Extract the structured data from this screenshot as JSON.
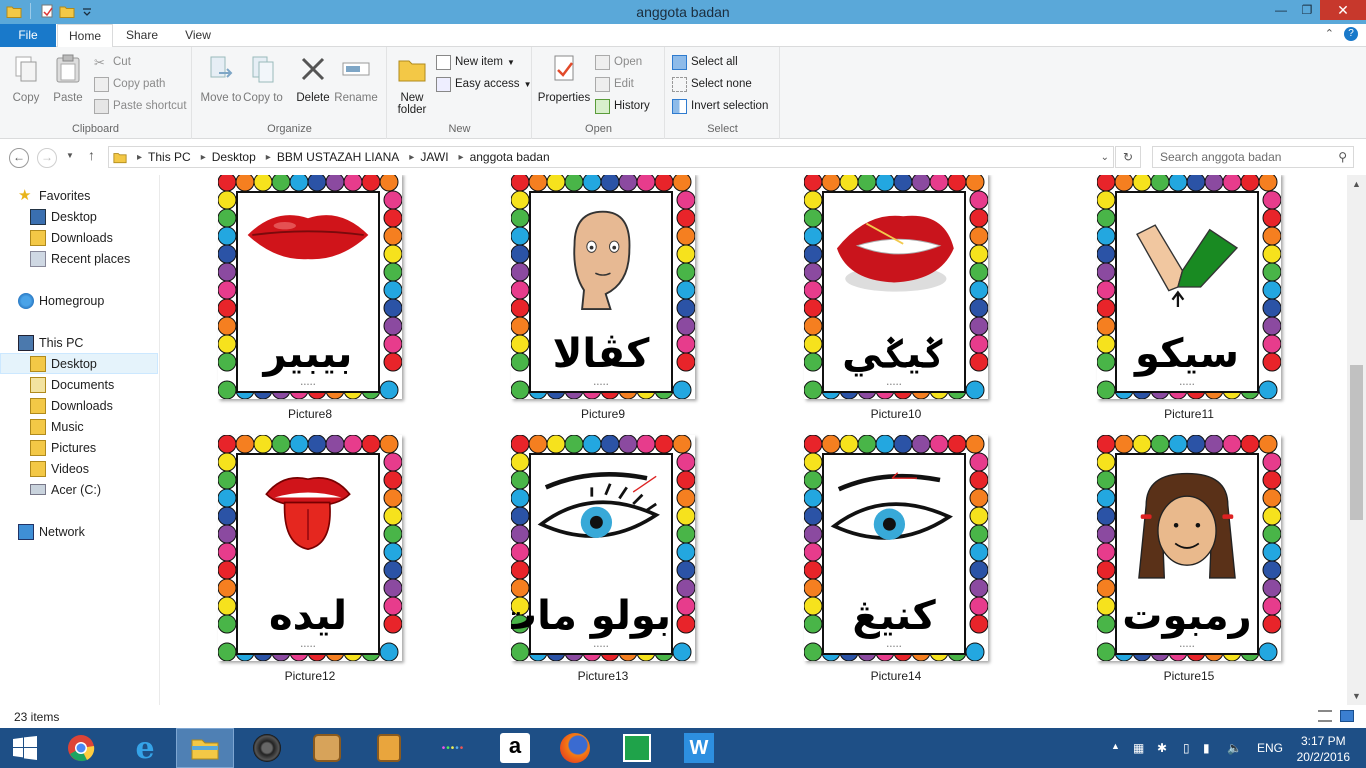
{
  "window": {
    "title": "anggota badan",
    "minimize": "—",
    "maximize": "❐",
    "close": "✕"
  },
  "ribbon_tabs": {
    "file": "File",
    "home": "Home",
    "share": "Share",
    "view": "View"
  },
  "ribbon": {
    "clipboard": {
      "label": "Clipboard",
      "copy": "Copy",
      "paste": "Paste",
      "cut": "Cut",
      "copy_path": "Copy path",
      "paste_shortcut": "Paste shortcut"
    },
    "organize": {
      "label": "Organize",
      "move_to": "Move to",
      "copy_to": "Copy to",
      "delete": "Delete",
      "rename": "Rename"
    },
    "new": {
      "label": "New",
      "new_folder": "New folder",
      "new_item": "New item",
      "easy_access": "Easy access"
    },
    "open": {
      "label": "Open",
      "properties": "Properties",
      "open": "Open",
      "edit": "Edit",
      "history": "History"
    },
    "select": {
      "label": "Select",
      "select_all": "Select all",
      "select_none": "Select none",
      "invert_selection": "Invert selection"
    }
  },
  "address": {
    "breadcrumbs": [
      "This PC",
      "Desktop",
      "BBM USTAZAH LIANA",
      "JAWI",
      "anggota badan"
    ],
    "search_placeholder": "Search anggota badan"
  },
  "nav": {
    "favorites": "Favorites",
    "fav_desktop": "Desktop",
    "fav_downloads": "Downloads",
    "recent_places": "Recent places",
    "homegroup": "Homegroup",
    "this_pc": "This PC",
    "desktop": "Desktop",
    "documents": "Documents",
    "downloads": "Downloads",
    "music": "Music",
    "pictures": "Pictures",
    "videos": "Videos",
    "drive": "Acer (C:)",
    "network": "Network"
  },
  "files": [
    {
      "name": "Picture8",
      "word": "بيبير",
      "picture": "lips-icon"
    },
    {
      "name": "Picture9",
      "word": "كڤالا",
      "picture": "head-icon"
    },
    {
      "name": "Picture10",
      "word": "ݢيݢي",
      "picture": "teeth-icon"
    },
    {
      "name": "Picture11",
      "word": "سيکو",
      "picture": "elbow-icon"
    },
    {
      "name": "Picture12",
      "word": "ليده",
      "picture": "tongue-icon"
    },
    {
      "name": "Picture13",
      "word": "بولو مات",
      "picture": "eyelash-icon"
    },
    {
      "name": "Picture14",
      "word": "كنيڠ",
      "picture": "eyebrow-icon"
    },
    {
      "name": "Picture15",
      "word": "رمبوت",
      "picture": "hair-icon"
    }
  ],
  "status": {
    "item_count": "23 items"
  },
  "taskbar": {
    "language": "ENG",
    "time": "3:17 PM",
    "date": "20/2/2016"
  },
  "colors": {
    "titlebar": "#5aa8d9",
    "file_tab": "#1979ca",
    "taskbar": "#1e4f86",
    "close": "#c7382c"
  }
}
